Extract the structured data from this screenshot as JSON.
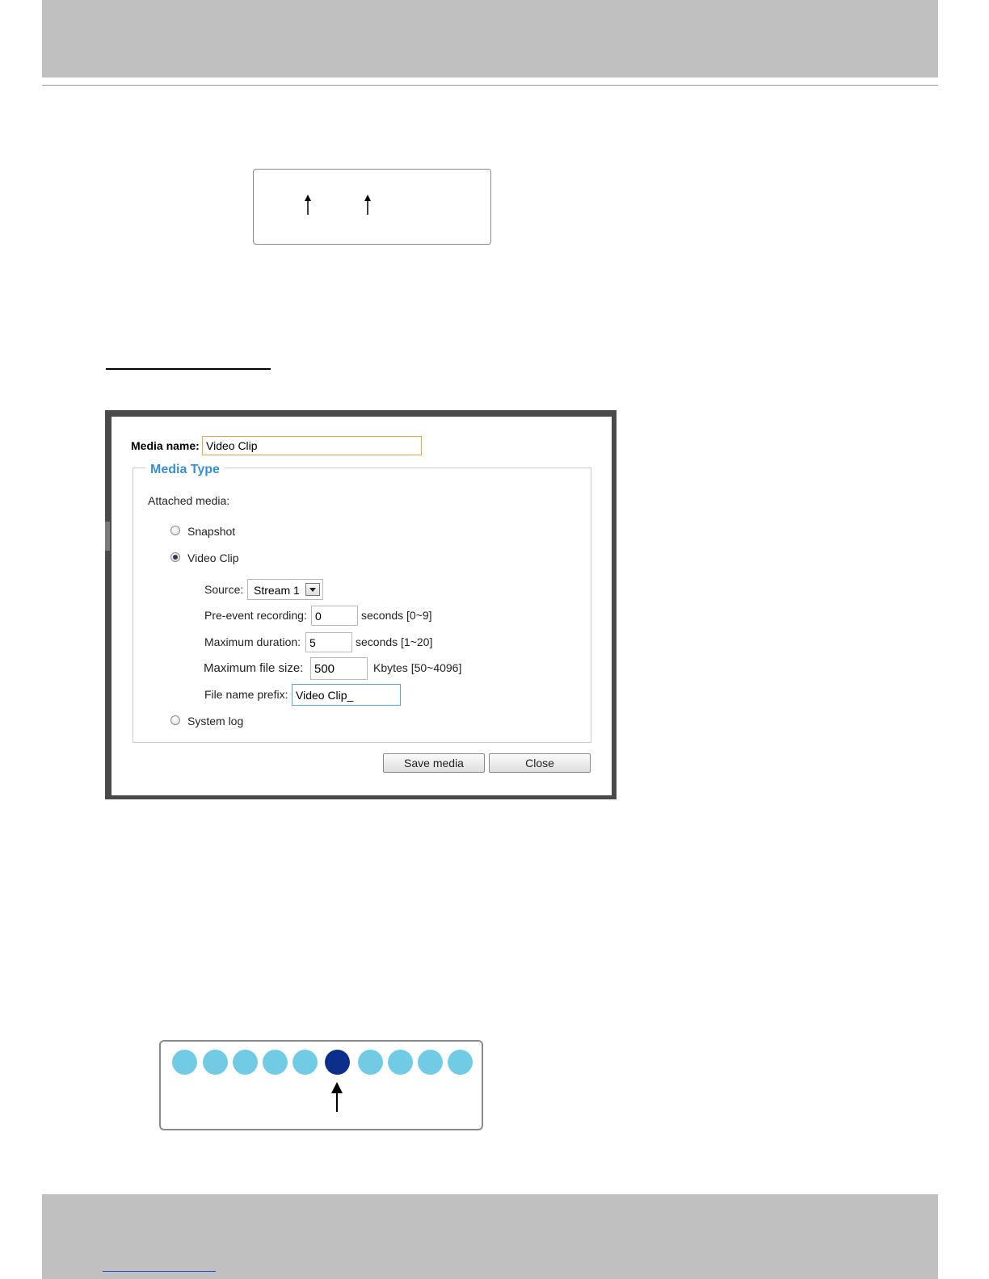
{
  "dialog": {
    "media_name_label": "Media name:",
    "media_name_value": "Video Clip",
    "legend": "Media Type",
    "attached_media_label": "Attached media:",
    "options": {
      "snapshot": "Snapshot",
      "video_clip": "Video Clip",
      "system_log": "System log"
    },
    "selected_option": "video_clip",
    "source_label": "Source:",
    "source_value": "Stream 1",
    "pre_event_label": "Pre-event recording:",
    "pre_event_value": "0",
    "pre_event_unit": "seconds [0~9]",
    "max_duration_label": "Maximum duration:",
    "max_duration_value": "5",
    "max_duration_unit": "seconds [1~20]",
    "max_file_size_label": "Maximum file size:",
    "max_file_size_value": "500",
    "max_file_size_unit": "Kbytes [50~4096]",
    "prefix_label": "File name prefix:",
    "prefix_value": "Video Clip_",
    "save_button": "Save media",
    "close_button": "Close"
  },
  "dots_figure": {
    "count": 10,
    "active_index": 5,
    "colors": {
      "inactive": "#72cbe5",
      "active": "#0b2f8a"
    }
  },
  "colors": {
    "header_bar": "#c0c0c0",
    "legend_blue": "#3a8fd0",
    "input_focus_orange": "#f0a050"
  }
}
